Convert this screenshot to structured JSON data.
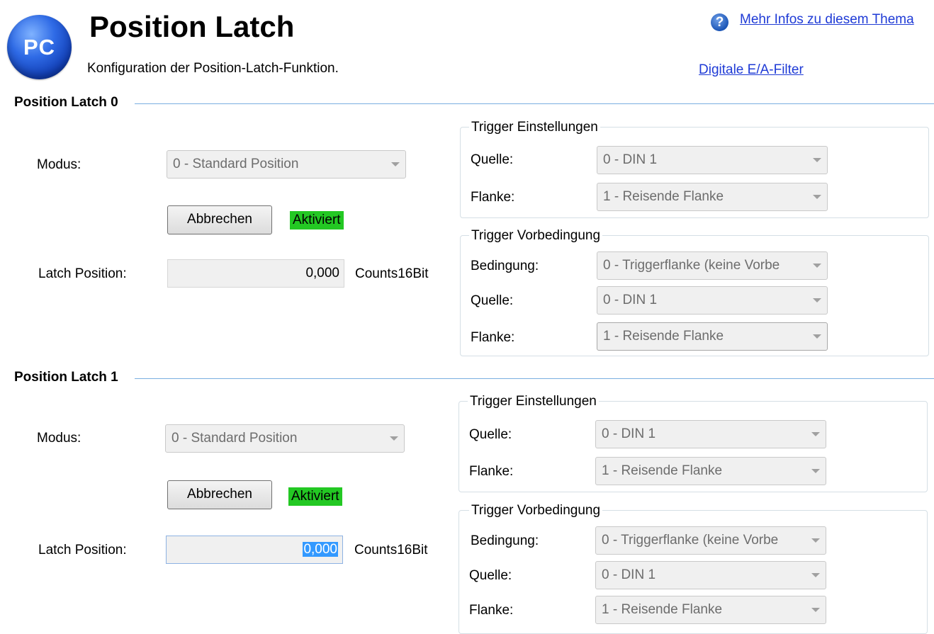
{
  "header": {
    "logo_text": "PC",
    "title": "Position Latch",
    "subtitle": "Konfiguration der Position-Latch-Funktion.",
    "help_icon_glyph": "?",
    "help_link": "Mehr Infos zu diesem Thema",
    "filter_link": "Digitale E/A-Filter"
  },
  "latch0": {
    "section_title": "Position Latch 0",
    "mode_label": "Modus:",
    "mode_value": "0 - Standard Position",
    "cancel_label": "Abbrechen",
    "status": "Aktiviert",
    "position_label": "Latch Position:",
    "position_value": "0,000",
    "unit": "Counts16Bit",
    "trigger": {
      "title": "Trigger Einstellungen",
      "source_label": "Quelle:",
      "source_value": "0 - DIN 1",
      "edge_label": "Flanke:",
      "edge_value": "1 - Reisende Flanke"
    },
    "precondition": {
      "title": "Trigger Vorbedingung",
      "condition_label": "Bedingung:",
      "condition_value": "0 - Triggerflanke (keine Vorbe",
      "source_label": "Quelle:",
      "source_value": "0 - DIN 1",
      "edge_label": "Flanke:",
      "edge_value": "1 - Reisende Flanke"
    }
  },
  "latch1": {
    "section_title": "Position Latch 1",
    "mode_label": "Modus:",
    "mode_value": "0 - Standard Position",
    "cancel_label": "Abbrechen",
    "status": "Aktiviert",
    "position_label": "Latch Position:",
    "position_value": "0,000",
    "unit": "Counts16Bit",
    "trigger": {
      "title": "Trigger Einstellungen",
      "source_label": "Quelle:",
      "source_value": "0 - DIN 1",
      "edge_label": "Flanke:",
      "edge_value": "1 - Reisende Flanke"
    },
    "precondition": {
      "title": "Trigger Vorbedingung",
      "condition_label": "Bedingung:",
      "condition_value": "0 - Triggerflanke (keine Vorbe",
      "source_label": "Quelle:",
      "source_value": "0 - DIN 1",
      "edge_label": "Flanke:",
      "edge_value": "1 - Reisende Flanke"
    }
  }
}
